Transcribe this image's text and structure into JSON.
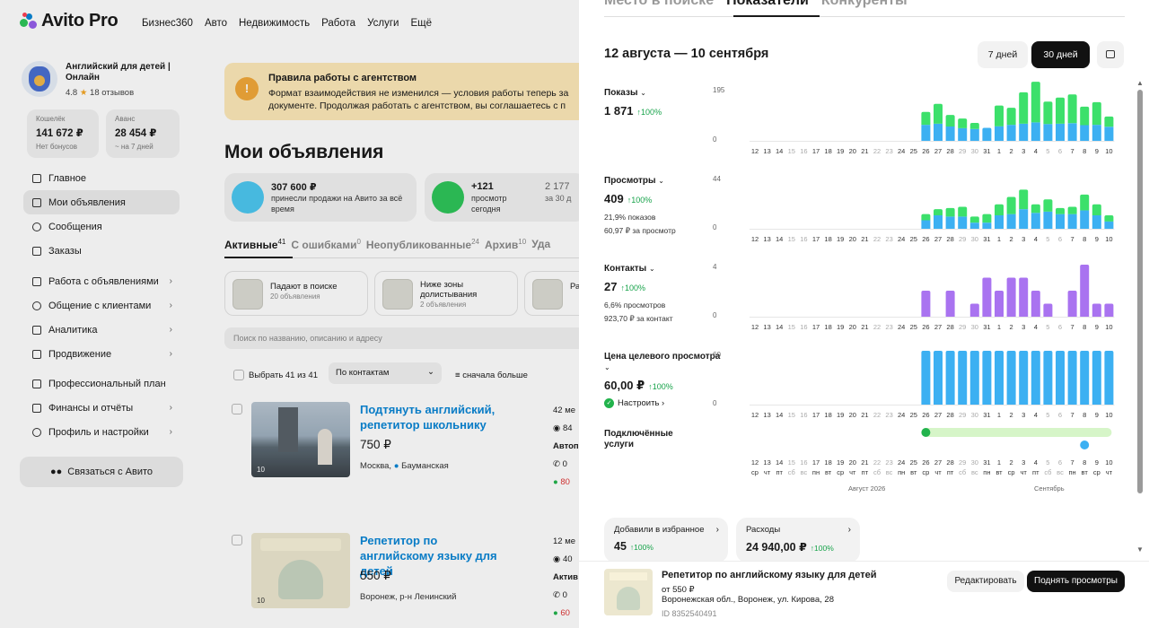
{
  "app": {
    "logo_text": "Avito Pro",
    "nav_links": [
      "Бизнес360",
      "Авто",
      "Недвижимость",
      "Работа",
      "Услуги",
      "Ещё"
    ]
  },
  "profile": {
    "name": "Английский для детей | Онлайн",
    "rating": "4.8",
    "reviews": "18 отзывов"
  },
  "wallets": [
    {
      "label": "Кошелёк",
      "value": "141 672 ₽",
      "sub": "Нет бонусов"
    },
    {
      "label": "Аванс",
      "value": "28 454 ₽",
      "sub": "~ на 7 дней"
    }
  ],
  "sidebar": {
    "group1": [
      "Главное",
      "Мои объявления",
      "Сообщения",
      "Заказы"
    ],
    "group2": [
      "Работа с объявлениями",
      "Общение с клиентами",
      "Аналитика",
      "Продвижение"
    ],
    "group3": [
      "Профессиональный план",
      "Финансы и отчёты",
      "Профиль и настройки"
    ],
    "contact_button": "Связаться с Авито"
  },
  "notice": {
    "title": "Правила работы с агентством",
    "text": "Формат взаимодействия не изменился — условия работы теперь за документе. Продолжая работать с агентством, вы соглашаетесь с п"
  },
  "main": {
    "title": "Мои объявления",
    "stats": [
      {
        "value": "307 600 ₽",
        "text": "принесли продажи на Авито за всё время"
      },
      {
        "value": "+121",
        "text": "просмотр сегодня"
      },
      {
        "value": "2 177",
        "text": "за 30 д"
      }
    ],
    "tabs": [
      {
        "label": "Активные",
        "count": "41"
      },
      {
        "label": "С ошибками",
        "count": "0"
      },
      {
        "label": "Неопубликованные",
        "count": "24"
      },
      {
        "label": "Архив",
        "count": "10"
      },
      {
        "label": "Уда",
        "count": ""
      }
    ],
    "filters": [
      {
        "title": "Падают в поиске",
        "sub": "20 объявления"
      },
      {
        "title": "Ниже зоны",
        "title2": "долистывания",
        "sub": "2 объявления"
      },
      {
        "title": "Ра",
        "sub": ""
      }
    ],
    "search_placeholder": "Поиск по названию, описанию и адресу",
    "select_all": "Выбрать 41 из 41",
    "sort_value": "По контактам",
    "order": "сначала больше"
  },
  "listings": [
    {
      "title": "Подтянуть английский, репетитор школьнику",
      "price": "750 ₽",
      "address": "Москва,",
      "metro": "Бауманская",
      "photos": "10",
      "side": [
        "42 ме",
        "84",
        "Автоп",
        "0",
        "80"
      ]
    },
    {
      "title": "Репетитор по английскому языку для детей",
      "price": "550 ₽",
      "address": "Воронеж, р-н Ленинский",
      "photos": "10",
      "side": [
        "12 ме",
        "40",
        "Актив",
        "0",
        "60"
      ]
    }
  ],
  "modal": {
    "tabs": [
      "Место в поиске",
      "Показатели",
      "Конкуренты"
    ],
    "period": "12 августа — 10 сентября",
    "range_buttons": [
      "7 дней",
      "30 дней"
    ],
    "metrics": [
      {
        "title": "Показы",
        "value": "1 871",
        "change": "↑100%",
        "subs": [],
        "ymax": "195",
        "ymin": "0"
      },
      {
        "title": "Просмотры",
        "value": "409",
        "change": "↑100%",
        "subs": [
          "21,9% показов",
          "60,97 ₽ за просмотр"
        ],
        "ymax": "44",
        "ymin": "0"
      },
      {
        "title": "Контакты",
        "value": "27",
        "change": "↑100%",
        "subs": [
          "6,6% просмотров",
          "923,70 ₽ за контакт"
        ],
        "ymax": "4",
        "ymin": "0"
      },
      {
        "title": "Цена целевого просмотра",
        "value": "60,00 ₽",
        "change": "↑100%",
        "subs": [],
        "setup": "Настроить ›",
        "ymax": "60",
        "ymin": "0"
      }
    ],
    "services_title": "Подключённые услуги",
    "days": [
      "12",
      "13",
      "14",
      "15",
      "16",
      "17",
      "18",
      "19",
      "20",
      "21",
      "22",
      "23",
      "24",
      "25",
      "26",
      "27",
      "28",
      "29",
      "30",
      "31",
      "1",
      "2",
      "3",
      "4",
      "5",
      "6",
      "7",
      "8",
      "9",
      "10"
    ],
    "weekdays": [
      "ср",
      "чт",
      "пт",
      "сб",
      "вс",
      "пн",
      "вт",
      "ср",
      "чт",
      "пт",
      "сб",
      "вс",
      "пн",
      "вт",
      "ср",
      "чт",
      "пт",
      "сб",
      "вс",
      "пн",
      "вт",
      "ср",
      "чт",
      "пт",
      "сб",
      "вс",
      "пн",
      "вт",
      "ср",
      "чт"
    ],
    "months": [
      "Август 2026",
      "Сентябрь"
    ],
    "cards": [
      {
        "title": "Добавили в избранное",
        "value": "45",
        "change": "↑100%"
      },
      {
        "title": "Расходы",
        "value": "24 940,00 ₽",
        "change": "↑100%"
      }
    ],
    "footer": {
      "title": "Репетитор по английскому языку для детей",
      "price": "от 550 ₽",
      "address": "Воронежская обл., Воронеж, ул. Кирова, 28",
      "id": "ID 8352540491",
      "edit": "Редактировать",
      "raise": "Поднять просмотры"
    }
  },
  "colors": {
    "blue": "#3cb0f2",
    "green": "#3ce06b",
    "purple": "#a973f0",
    "service_bar": "#d6f5c8"
  },
  "chart_data": [
    {
      "type": "bar",
      "title": "Показы",
      "categories": [
        "12",
        "13",
        "14",
        "15",
        "16",
        "17",
        "18",
        "19",
        "20",
        "21",
        "22",
        "23",
        "24",
        "25",
        "26",
        "27",
        "28",
        "29",
        "30",
        "31",
        "1",
        "2",
        "3",
        "4",
        "5",
        "6",
        "7",
        "8",
        "9",
        "10"
      ],
      "ylim": [
        0,
        195
      ],
      "series": [
        {
          "name": "",
          "values": [
            0,
            0,
            0,
            0,
            0,
            0,
            0,
            0,
            0,
            0,
            0,
            0,
            0,
            0,
            58,
            62,
            52,
            46,
            43,
            47,
            53,
            58,
            62,
            67,
            61,
            62,
            64,
            57,
            58,
            51
          ]
        },
        {
          "name": "",
          "values": [
            0,
            0,
            0,
            0,
            0,
            0,
            0,
            0,
            0,
            0,
            0,
            0,
            0,
            0,
            47,
            72,
            42,
            35,
            22,
            0,
            75,
            62,
            114,
            147,
            81,
            95,
            104,
            67,
            82,
            37
          ]
        }
      ]
    },
    {
      "type": "bar",
      "title": "Просмотры",
      "categories": [
        "12",
        "13",
        "14",
        "15",
        "16",
        "17",
        "18",
        "19",
        "20",
        "21",
        "22",
        "23",
        "24",
        "25",
        "26",
        "27",
        "28",
        "29",
        "30",
        "31",
        "1",
        "2",
        "3",
        "4",
        "5",
        "6",
        "7",
        "8",
        "9",
        "10"
      ],
      "ylim": [
        0,
        44
      ],
      "series": [
        {
          "name": "",
          "values": [
            0,
            0,
            0,
            0,
            0,
            0,
            0,
            0,
            0,
            0,
            0,
            0,
            0,
            0,
            7,
            11,
            10,
            10,
            5,
            5,
            11,
            12,
            16,
            13,
            14,
            12,
            12,
            15,
            11,
            6
          ]
        },
        {
          "name": "",
          "values": [
            0,
            0,
            0,
            0,
            0,
            0,
            0,
            0,
            0,
            0,
            0,
            0,
            0,
            0,
            5,
            5,
            7,
            8,
            5,
            7,
            9,
            14,
            16,
            7,
            10,
            5,
            6,
            13,
            9,
            5
          ]
        }
      ]
    },
    {
      "type": "bar",
      "title": "Контакты",
      "categories": [
        "12",
        "13",
        "14",
        "15",
        "16",
        "17",
        "18",
        "19",
        "20",
        "21",
        "22",
        "23",
        "24",
        "25",
        "26",
        "27",
        "28",
        "29",
        "30",
        "31",
        "1",
        "2",
        "3",
        "4",
        "5",
        "6",
        "7",
        "8",
        "9",
        "10"
      ],
      "ylim": [
        0,
        4
      ],
      "series": [
        {
          "name": "",
          "values": [
            0,
            0,
            0,
            0,
            0,
            0,
            0,
            0,
            0,
            0,
            0,
            0,
            0,
            0,
            2,
            0,
            2,
            0,
            1,
            3,
            2,
            3,
            3,
            2,
            1,
            0,
            2,
            4,
            1,
            1
          ]
        }
      ]
    },
    {
      "type": "bar",
      "title": "Цена целевого просмотра",
      "categories": [
        "12",
        "13",
        "14",
        "15",
        "16",
        "17",
        "18",
        "19",
        "20",
        "21",
        "22",
        "23",
        "24",
        "25",
        "26",
        "27",
        "28",
        "29",
        "30",
        "31",
        "1",
        "2",
        "3",
        "4",
        "5",
        "6",
        "7",
        "8",
        "9",
        "10"
      ],
      "ylim": [
        0,
        60
      ],
      "series": [
        {
          "name": "",
          "values": [
            0,
            0,
            0,
            0,
            0,
            0,
            0,
            0,
            0,
            0,
            0,
            0,
            0,
            0,
            60,
            60,
            60,
            60,
            60,
            60,
            60,
            60,
            60,
            60,
            60,
            60,
            60,
            60,
            60,
            60
          ]
        }
      ]
    }
  ]
}
